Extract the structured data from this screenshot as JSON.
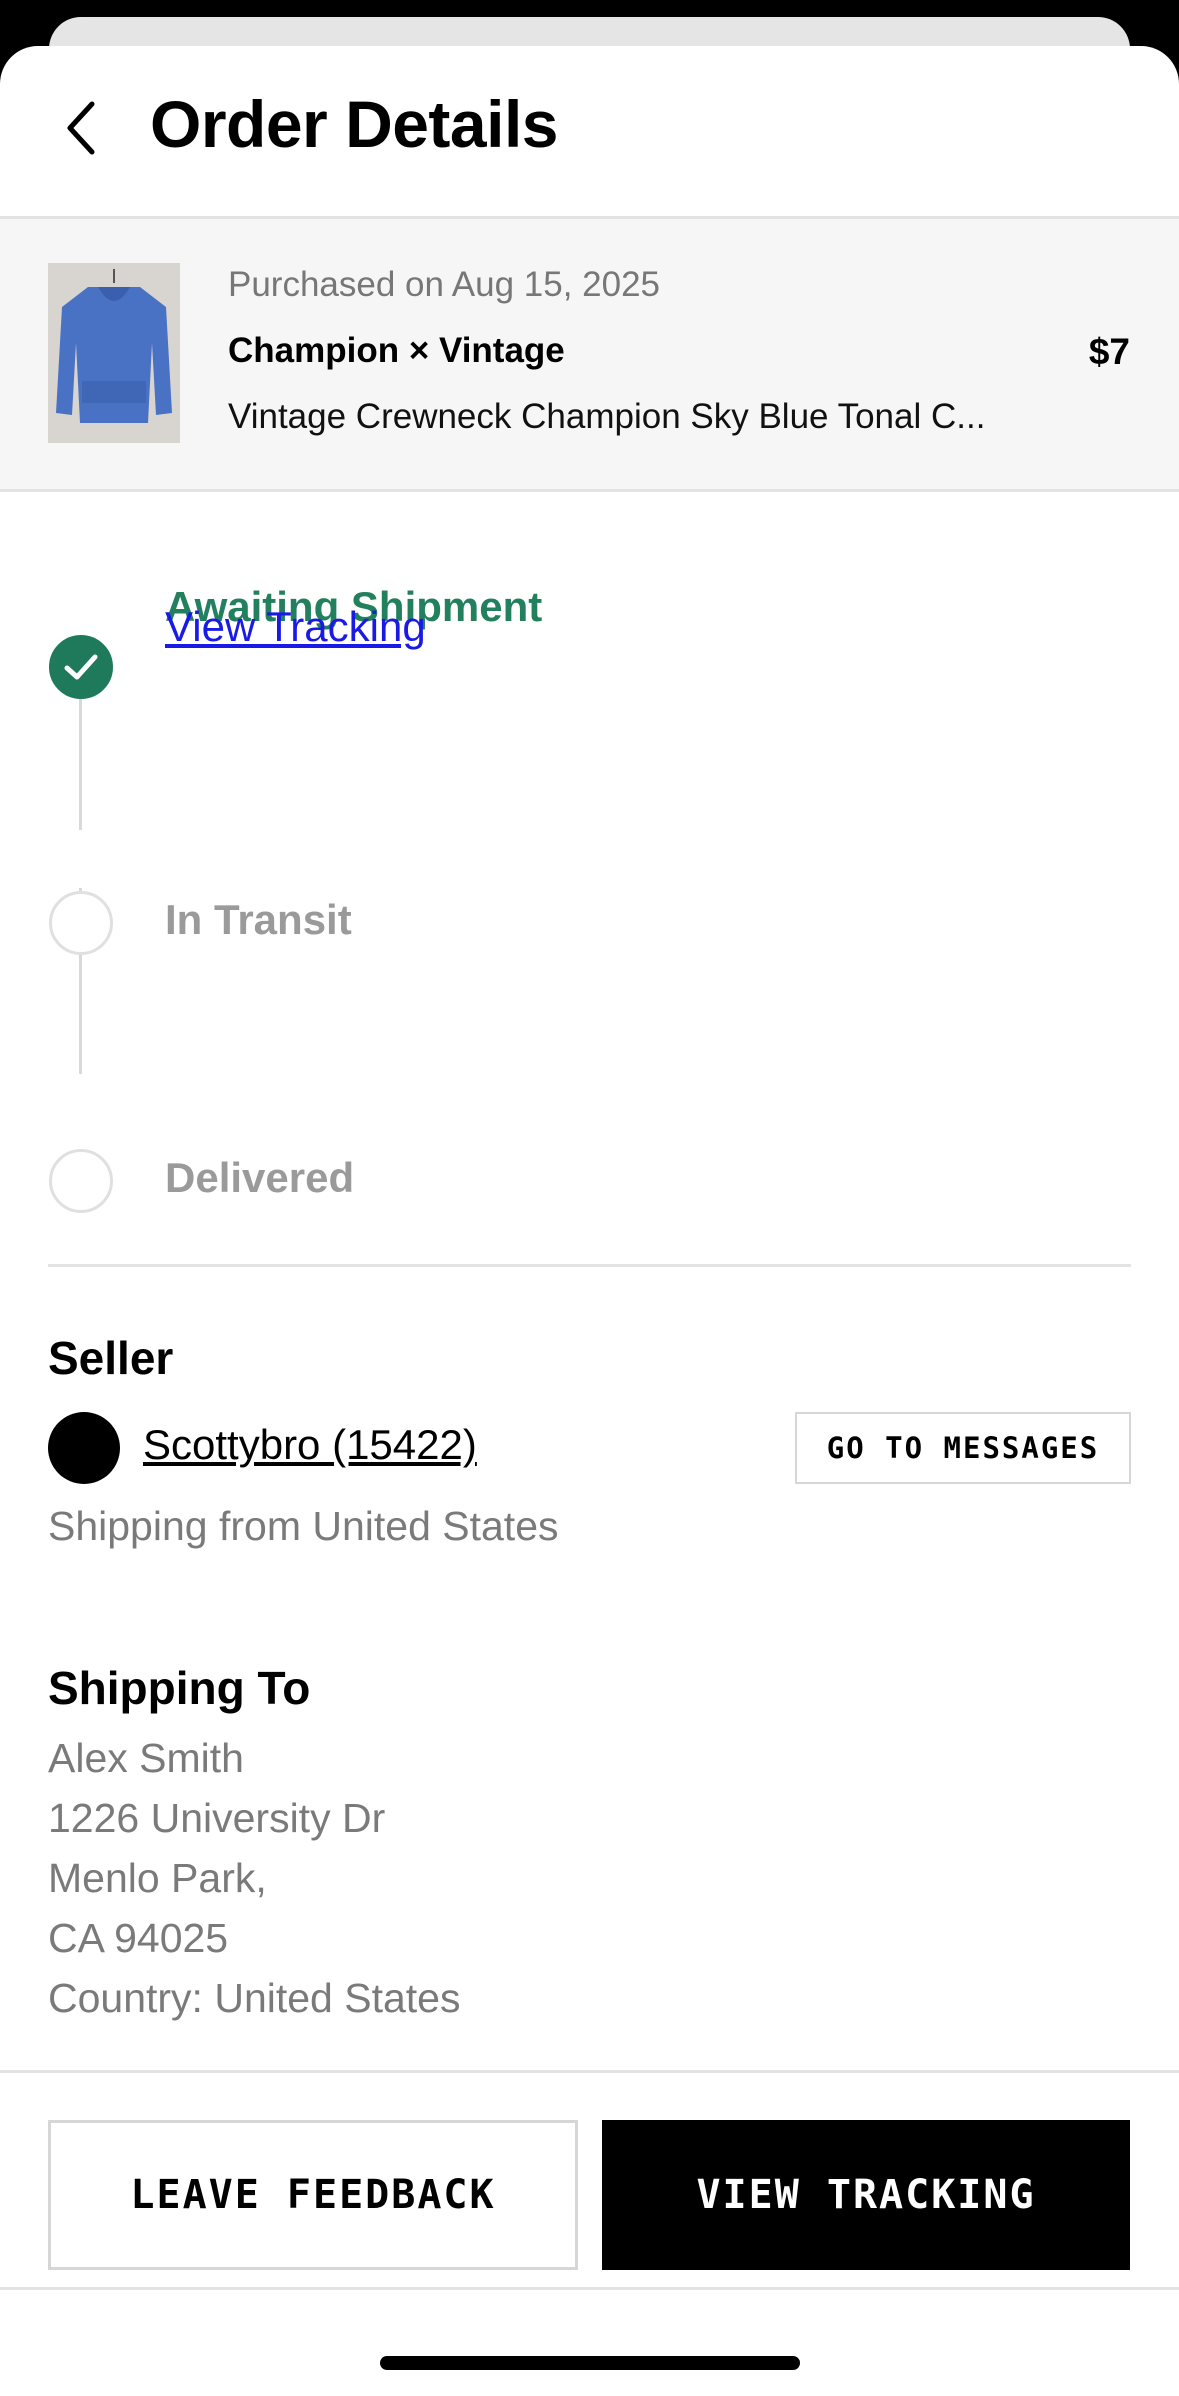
{
  "header": {
    "title": "Order Details",
    "back_icon": "chevron-left-icon"
  },
  "product": {
    "purchased": "Purchased on Aug 15, 2025",
    "brand": "Champion × Vintage",
    "price": "$7",
    "name": "Vintage Crewneck Champion Sky Blue Tonal C...",
    "thumbnail_color": "#4a72c4"
  },
  "status": {
    "accent_color": "#23805f",
    "steps": [
      {
        "label": "Awaiting Shipment",
        "state": "complete"
      },
      {
        "label": "In Transit",
        "state": "pending"
      },
      {
        "label": "Delivered",
        "state": "pending"
      }
    ],
    "tracking_link": "View Tracking"
  },
  "seller": {
    "heading": "Seller",
    "name": "Scottybro (15422)",
    "messages_button": "GO TO MESSAGES",
    "shipping_from": "Shipping from United States"
  },
  "shipping_to": {
    "heading": "Shipping To",
    "lines": [
      "Alex Smith",
      "1226 University Dr",
      "Menlo Park,",
      "CA 94025",
      "Country: United States"
    ]
  },
  "actions": {
    "leave_feedback": "LEAVE FEEDBACK",
    "view_tracking": "VIEW TRACKING"
  }
}
